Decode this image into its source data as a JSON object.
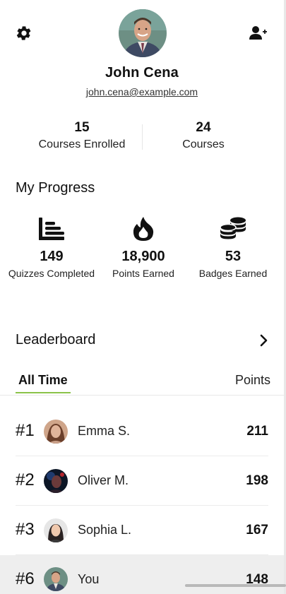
{
  "profile": {
    "name": "John Cena",
    "email": "john.cena@example.com"
  },
  "stats": [
    {
      "value": "15",
      "label": "Courses Enrolled"
    },
    {
      "value": "24",
      "label": "Courses"
    }
  ],
  "progress": {
    "title": "My Progress",
    "items": [
      {
        "icon": "bar-chart-icon",
        "value": "149",
        "label": "Quizzes Completed"
      },
      {
        "icon": "fire-icon",
        "value": "18,900",
        "label": "Points Earned"
      },
      {
        "icon": "coins-icon",
        "value": "53",
        "label": "Badges Earned"
      }
    ]
  },
  "leaderboard": {
    "title": "Leaderboard",
    "tab": "All Time",
    "points_header": "Points",
    "rows": [
      {
        "rank": "#1",
        "name": "Emma S.",
        "points": "211"
      },
      {
        "rank": "#2",
        "name": "Oliver M.",
        "points": "198"
      },
      {
        "rank": "#3",
        "name": "Sophia L.",
        "points": "167"
      },
      {
        "rank": "#6",
        "name": "You",
        "points": "148"
      }
    ]
  },
  "icons": {
    "settings": "gear-icon",
    "add_user": "add-user-icon",
    "chevron": "chevron-right-icon"
  },
  "colors": {
    "tab_underline": "#8bc34a",
    "current_user_row": "#eeeeee"
  }
}
